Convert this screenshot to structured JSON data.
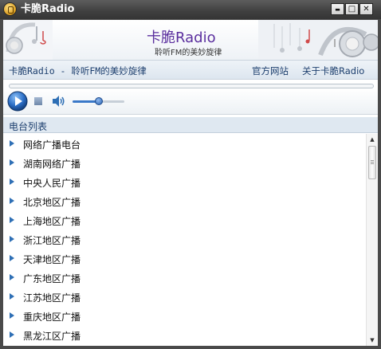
{
  "window": {
    "title": "卡脆Radio",
    "controls": {
      "minimize": "▬",
      "maximize": "□",
      "close": "✕"
    }
  },
  "banner": {
    "brand": "卡脆Radio",
    "tagline": "聆听FM的美妙旋律"
  },
  "nav": {
    "left_text": "卡脆Radio - 聆听FM的美妙旋律",
    "links": [
      "官方网站",
      "关于卡脆Radio"
    ]
  },
  "player": {
    "play_icon": "play-icon",
    "stop_icon": "stop-icon",
    "volume_icon": "speaker-icon",
    "volume_level": 0.5
  },
  "station_list": {
    "header": "电台列表",
    "items": [
      "网络广播电台",
      "湖南网络广播",
      "中央人民广播",
      "北京地区广播",
      "上海地区广播",
      "浙江地区广播",
      "天津地区广播",
      "广东地区广播",
      "江苏地区广播",
      "重庆地区广播",
      "黑龙江区广播"
    ]
  },
  "colors": {
    "accent": "#2e6fb5",
    "brand": "#5b2f9e",
    "link": "#1d3f6e",
    "titlebar": "#3f3f3f"
  }
}
